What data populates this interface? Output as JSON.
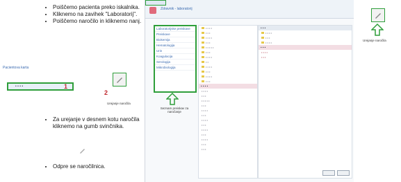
{
  "bullets_top": [
    "Poiščemo pacienta preko iskalnika.",
    "Kliknemo na zavihek \"Laboratorij\".",
    "Poiščemo naročilo in kliknemo nanj."
  ],
  "bullets_mid": [
    "Za urejanje v desnem kotu naročila kliknemo na gumb svinčnika."
  ],
  "bullets_bottom": [
    "Odpre se naročilnica."
  ],
  "mini": {
    "title": "Pacientova karta",
    "num1": "1",
    "num2": "2",
    "pen_caption": "Urejanje naročila"
  },
  "app": {
    "title": "Zdravnik - laboratorij",
    "leftnav": [
      "Laboratorijske preiskave",
      "Preiskave",
      "Biokemija",
      "Hematologija",
      "Urin",
      "Koagulacija",
      "Serologija",
      "Mikrobiologija"
    ],
    "nav_caption": "Seznam preiskav za naročanje",
    "right_caption": "Urejanje naročila"
  },
  "colors": {
    "highlight": "#2e9e3a",
    "marker": "#c0272d"
  }
}
